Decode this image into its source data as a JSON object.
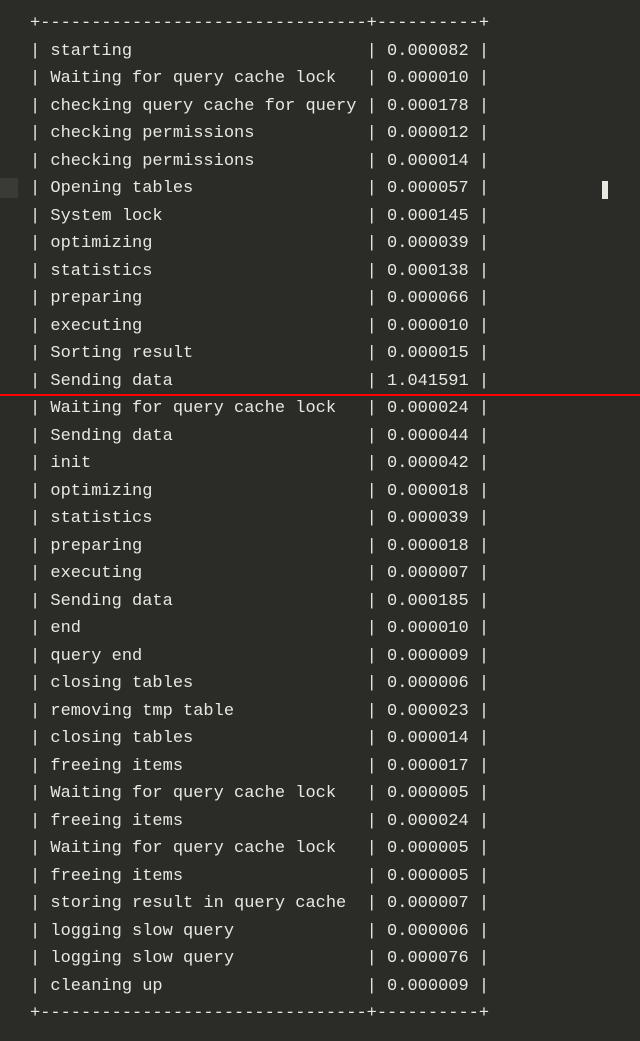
{
  "separator_top": "+--------------------------------+----------+",
  "separator_bottom": "+--------------------------------+----------+",
  "rows": [
    {
      "status": "starting",
      "duration": "0.000082"
    },
    {
      "status": "Waiting for query cache lock",
      "duration": "0.000010"
    },
    {
      "status": "checking query cache for query",
      "duration": "0.000178"
    },
    {
      "status": "checking permissions",
      "duration": "0.000012"
    },
    {
      "status": "checking permissions",
      "duration": "0.000014"
    },
    {
      "status": "Opening tables",
      "duration": "0.000057"
    },
    {
      "status": "System lock",
      "duration": "0.000145"
    },
    {
      "status": "optimizing",
      "duration": "0.000039"
    },
    {
      "status": "statistics",
      "duration": "0.000138"
    },
    {
      "status": "preparing",
      "duration": "0.000066"
    },
    {
      "status": "executing",
      "duration": "0.000010"
    },
    {
      "status": "Sorting result",
      "duration": "0.000015"
    },
    {
      "status": "Sending data",
      "duration": "1.041591"
    },
    {
      "status": "Waiting for query cache lock",
      "duration": "0.000024"
    },
    {
      "status": "Sending data",
      "duration": "0.000044"
    },
    {
      "status": "init",
      "duration": "0.000042"
    },
    {
      "status": "optimizing",
      "duration": "0.000018"
    },
    {
      "status": "statistics",
      "duration": "0.000039"
    },
    {
      "status": "preparing",
      "duration": "0.000018"
    },
    {
      "status": "executing",
      "duration": "0.000007"
    },
    {
      "status": "Sending data",
      "duration": "0.000185"
    },
    {
      "status": "end",
      "duration": "0.000010"
    },
    {
      "status": "query end",
      "duration": "0.000009"
    },
    {
      "status": "closing tables",
      "duration": "0.000006"
    },
    {
      "status": "removing tmp table",
      "duration": "0.000023"
    },
    {
      "status": "closing tables",
      "duration": "0.000014"
    },
    {
      "status": "freeing items",
      "duration": "0.000017"
    },
    {
      "status": "Waiting for query cache lock",
      "duration": "0.000005"
    },
    {
      "status": "freeing items",
      "duration": "0.000024"
    },
    {
      "status": "Waiting for query cache lock",
      "duration": "0.000005"
    },
    {
      "status": "freeing items",
      "duration": "0.000005"
    },
    {
      "status": "storing result in query cache",
      "duration": "0.000007"
    },
    {
      "status": "logging slow query",
      "duration": "0.000006"
    },
    {
      "status": "logging slow query",
      "duration": "0.000076"
    },
    {
      "status": "cleaning up",
      "duration": "0.000009"
    }
  ],
  "highlight_after_row_index": 12,
  "col1_width": 30
}
